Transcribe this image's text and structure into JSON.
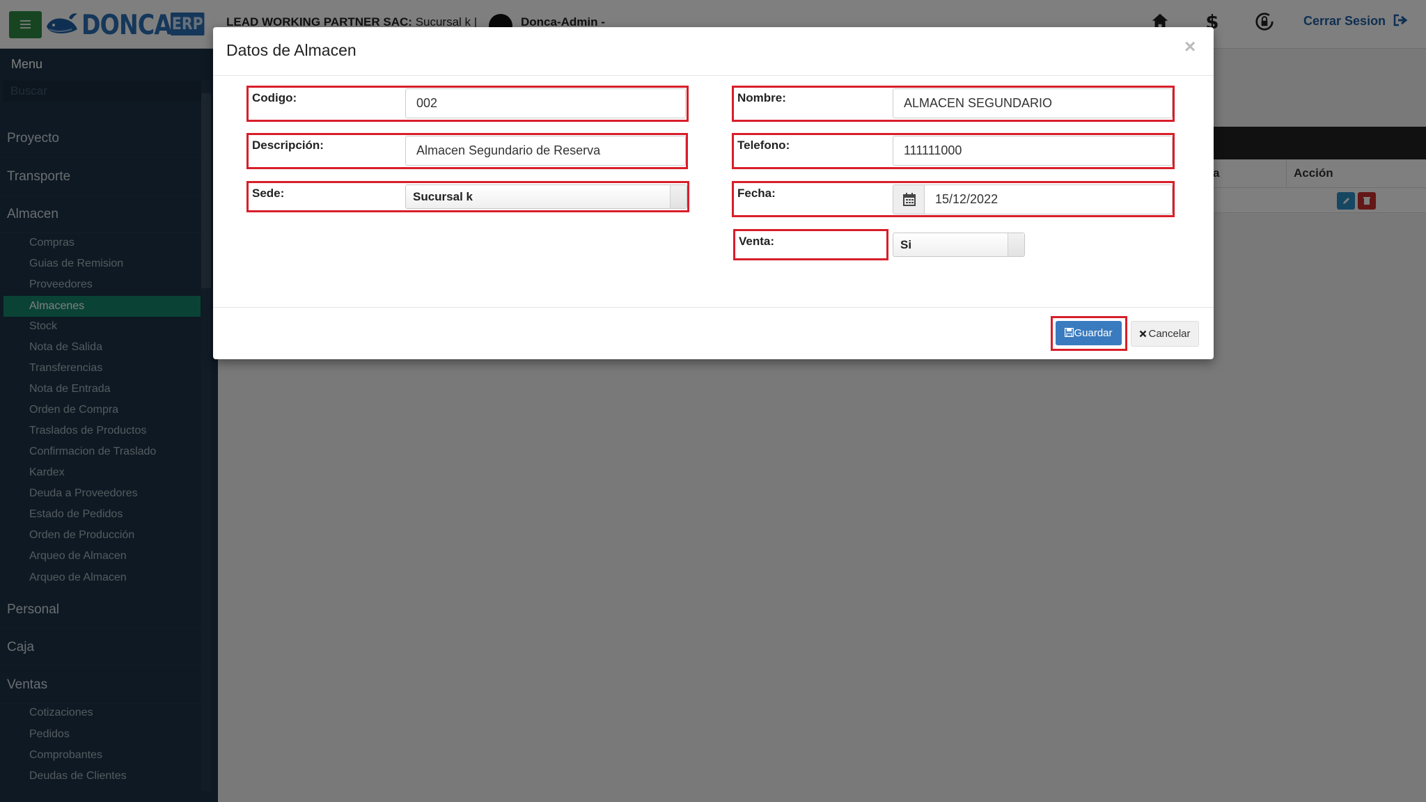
{
  "brand": {
    "name": "DONCA",
    "suffix": "ERP"
  },
  "header": {
    "company": "LEAD WORKING PARTNER SAC:",
    "branch": "Sucursal k |",
    "user": "Donca-Admin -",
    "logout_label": "Cerrar Sesion"
  },
  "sidebar": {
    "title": "Menu",
    "search_placeholder": "Buscar",
    "sections": {
      "proyecto": "Proyecto",
      "transporte": "Transporte",
      "almacen": "Almacen",
      "personal": "Personal",
      "caja": "Caja",
      "ventas": "Ventas"
    },
    "almacen_items": [
      "Compras",
      "Guias de Remision",
      "Proveedores",
      "Almacenes",
      "Stock",
      "Nota de Salida",
      "Transferencias",
      "Nota de Entrada",
      "Orden de Compra",
      "Traslados de Productos",
      "Confirmacion de Traslado",
      "Kardex",
      "Deuda a Proveedores",
      "Estado de Pedidos",
      "Orden de Producción",
      "Arqueo de Almacen",
      "Arqueo de Almacen"
    ],
    "ventas_items": [
      "Cotizaciones",
      "Pedidos",
      "Comprobantes",
      "Deudas de Clientes"
    ],
    "active_item": "Almacenes"
  },
  "table": {
    "col_partial": "a",
    "col_action": "Acción"
  },
  "modal": {
    "title": "Datos de Almacen",
    "close": "×",
    "fields": {
      "codigo": {
        "label": "Codigo:",
        "value": "002"
      },
      "nombre": {
        "label": "Nombre:",
        "value": "ALMACEN SEGUNDARIO"
      },
      "descripcion": {
        "label": "Descripción:",
        "value": "Almacen Segundario de Reserva"
      },
      "telefono": {
        "label": "Telefono:",
        "value": "111111000"
      },
      "sede": {
        "label": "Sede:",
        "value": "Sucursal k"
      },
      "fecha": {
        "label": "Fecha:",
        "value": "15/12/2022"
      },
      "venta": {
        "label": "Venta:",
        "value": "Si"
      }
    },
    "save_label": "Guardar",
    "cancel_label": "Cancelar"
  },
  "colors": {
    "accent": "#2a6fb5",
    "active_menu": "#14866a",
    "highlight": "#d81e2a",
    "sidebar": "#1d3347"
  },
  "icons": [
    "menu-icon",
    "whale-logo",
    "user-avatar",
    "home-icon",
    "dollar-icon",
    "lock-icon",
    "sign-out-icon",
    "calendar-icon",
    "save-icon",
    "times-icon",
    "pencil-icon",
    "trash-icon"
  ]
}
